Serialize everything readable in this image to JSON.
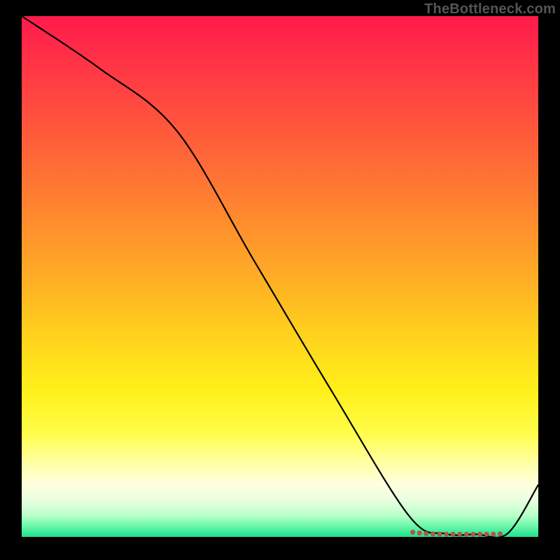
{
  "watermark": {
    "text": "TheBottleneck.com"
  },
  "chart_data": {
    "type": "line",
    "title": "",
    "xlabel": "",
    "ylabel": "",
    "xlim": [
      0,
      100
    ],
    "ylim": [
      0,
      100
    ],
    "grid": false,
    "legend": null,
    "series": [
      {
        "name": "curve",
        "x": [
          0,
          15,
          30,
          45,
          60,
          75,
          82,
          88,
          94,
          100
        ],
        "y": [
          100,
          90,
          78,
          53,
          28,
          4,
          0.6,
          0.5,
          0.6,
          10
        ]
      }
    ],
    "markers": {
      "name": "dots",
      "color": "#c05048",
      "x": [
        75.7,
        77.0,
        78.3,
        79.6,
        80.9,
        82.2,
        83.5,
        84.8,
        86.1,
        87.4,
        88.7,
        90.0,
        91.3,
        92.6
      ],
      "y": [
        0.9,
        0.75,
        0.65,
        0.58,
        0.54,
        0.52,
        0.51,
        0.5,
        0.5,
        0.5,
        0.51,
        0.52,
        0.54,
        0.57
      ]
    },
    "gradient": {
      "direction": "vertical",
      "stops": [
        {
          "pos": 0.0,
          "color": "#ff1a4b"
        },
        {
          "pos": 0.28,
          "color": "#ff6a36"
        },
        {
          "pos": 0.62,
          "color": "#ffd41d"
        },
        {
          "pos": 0.86,
          "color": "#ffffa8"
        },
        {
          "pos": 1.0,
          "color": "#1de28e"
        }
      ]
    }
  }
}
